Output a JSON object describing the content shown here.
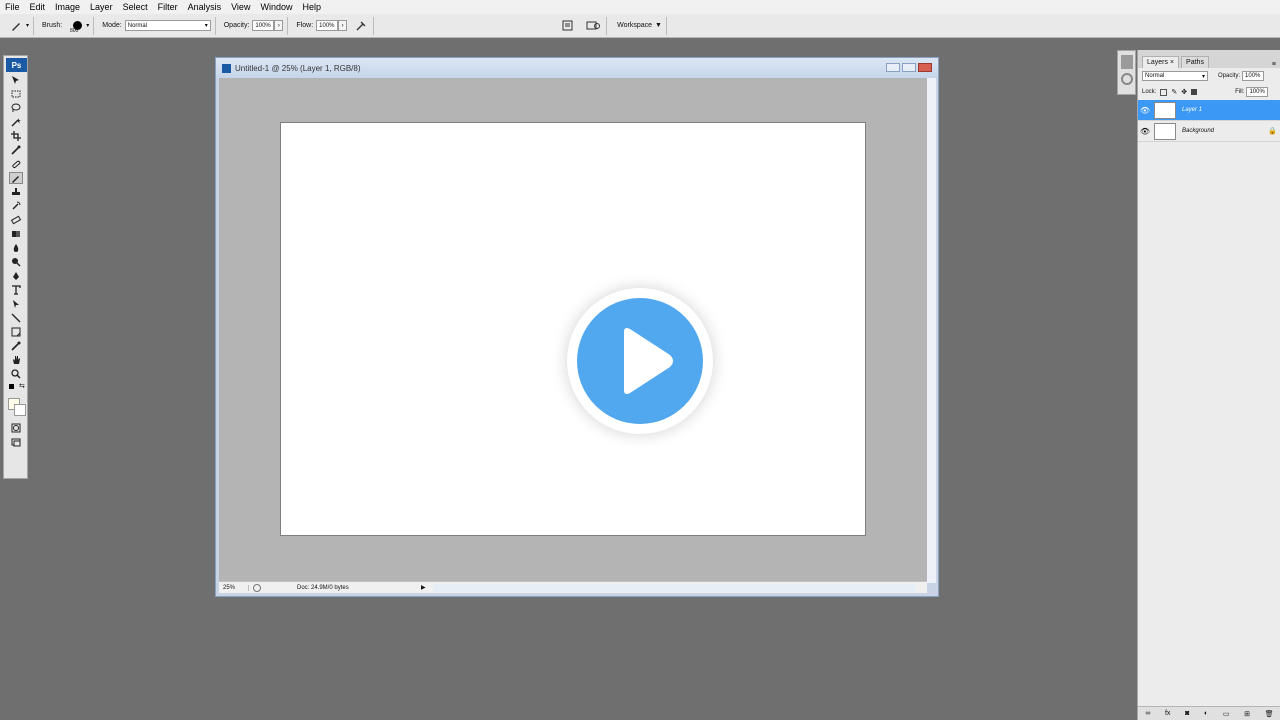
{
  "menu": [
    "File",
    "Edit",
    "Image",
    "Layer",
    "Select",
    "Filter",
    "Analysis",
    "View",
    "Window",
    "Help"
  ],
  "options": {
    "brush_label": "Brush:",
    "brush_size": "800",
    "mode_label": "Mode:",
    "mode_value": "Normal",
    "opacity_label": "Opacity:",
    "opacity_value": "100%",
    "flow_label": "Flow:",
    "flow_value": "100%",
    "workspace_label": "Workspace"
  },
  "tools": {
    "logo": "Ps",
    "items": [
      "move-icon",
      "marquee-icon",
      "lasso-icon",
      "magic-wand-icon",
      "crop-icon",
      "eyedropper-icon",
      "healing-brush-icon",
      "brush-icon",
      "clone-stamp-icon",
      "history-brush-icon",
      "eraser-icon",
      "gradient-icon",
      "blur-icon",
      "dodge-icon",
      "pen-icon",
      "type-icon",
      "path-selection-icon",
      "line-icon",
      "notes-icon",
      "eyedropper2-icon",
      "hand-icon",
      "zoom-icon"
    ]
  },
  "document": {
    "title": "Untitled-1 @ 25% (Layer 1, RGB/8)",
    "zoom": "25%",
    "doc_info": "Doc: 24.9M/0 bytes"
  },
  "layers_panel": {
    "tab_layers": "Layers ×",
    "tab_paths": "Paths",
    "blend_mode": "Normal",
    "opacity_label": "Opacity:",
    "opacity_value": "100%",
    "lock_label": "Lock:",
    "fill_label": "Fill:",
    "fill_value": "100%",
    "layers": [
      {
        "name": "Layer 1",
        "active": true
      },
      {
        "name": "Background",
        "active": false
      }
    ]
  },
  "colors": {
    "accent": "#3b99f5",
    "play": "#52a8ef",
    "workspace_bg": "#6f6f6f"
  }
}
